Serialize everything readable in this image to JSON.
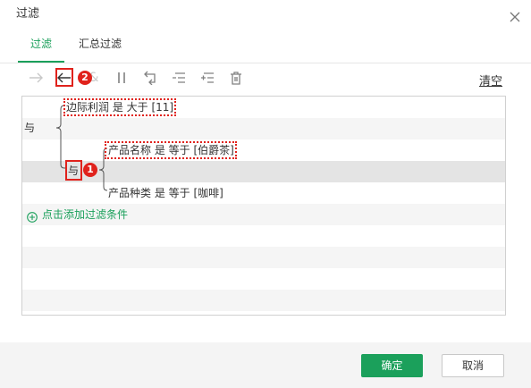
{
  "dialog": {
    "title": "过滤"
  },
  "tabs": [
    {
      "label": "过滤",
      "active": true
    },
    {
      "label": "汇总过滤",
      "active": false
    }
  ],
  "toolbar": {
    "items": [
      {
        "icon": "arrow-right-icon",
        "enabled": false
      },
      {
        "icon": "arrow-left-icon",
        "enabled": true
      },
      {
        "icon": "ampersand-icon",
        "enabled": false
      },
      {
        "icon": "parallel-bars-icon",
        "enabled": true
      },
      {
        "icon": "return-arrow-icon",
        "enabled": true
      },
      {
        "icon": "list-remove-icon",
        "enabled": true
      },
      {
        "icon": "list-add-icon",
        "enabled": true
      },
      {
        "icon": "trash-icon",
        "enabled": true
      }
    ],
    "clear_label": "清空"
  },
  "filter": {
    "outer_connector": "与",
    "condition_1": "边际利润 是 大于 [11]",
    "group": {
      "connector": "与",
      "condition_1": "产品名称 是 等于 [伯爵茶]",
      "condition_2": "产品种类 是 等于 [咖啡]"
    },
    "add_condition_label": "点击添加过滤条件"
  },
  "annotations": {
    "marker_1": "1",
    "marker_2": "2"
  },
  "footer": {
    "confirm_label": "确定",
    "cancel_label": "取消"
  },
  "colors": {
    "accent": "#1ba05b",
    "annotation": "#e0221c"
  }
}
